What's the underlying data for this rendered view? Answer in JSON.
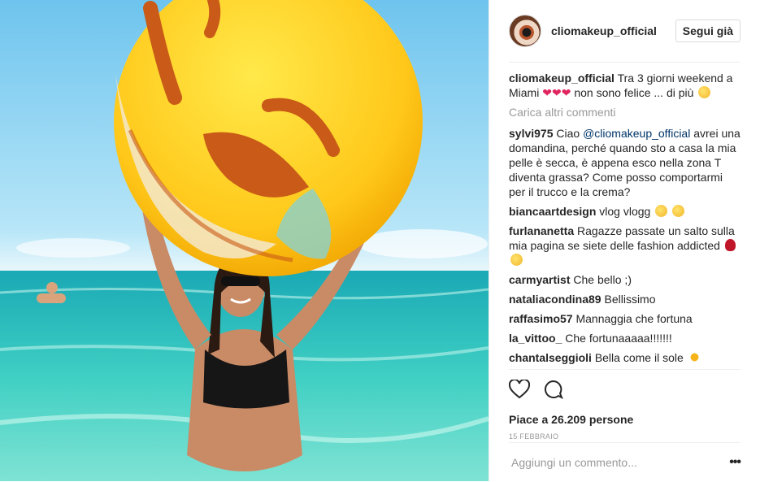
{
  "header": {
    "username": "cliomakeup_official",
    "follow_label": "Segui già"
  },
  "caption": {
    "user": "cliomakeup_official",
    "text_1": "Tra 3 giorni weekend a Miami",
    "hearts": "❤❤❤",
    "text_2": "non sono felice ... di più"
  },
  "load_more_label": "Carica altri commenti",
  "comments": [
    {
      "user": "sylvi975",
      "prefix": "Ciao",
      "mention": "@cliomakeup_official",
      "text": "avrei una domandina, perché quando sto a casa la mia pelle è secca, è appena esco nella zona T diventa grassa? Come posso comportarmi per il trucco e la crema?"
    },
    {
      "user": "biancaartdesign",
      "text": "vlog vlogg"
    },
    {
      "user": "furlananetta",
      "text": "Ragazze passate un salto sulla mia pagina se siete delle fashion addicted"
    },
    {
      "user": "carmyartist",
      "text": "Che bello ;)"
    },
    {
      "user": "nataliacondina89",
      "text": "Bellissimo"
    },
    {
      "user": "raffasimo57",
      "text": "Mannaggia che fortuna"
    },
    {
      "user": "la_vittoo_",
      "text": "Che fortunaaaaa!!!!!!!"
    },
    {
      "user": "chantalseggioli",
      "text": "Bella come il sole"
    }
  ],
  "likes_text": "Piace a 26.209 persone",
  "date": "15 FEBBRAIO",
  "comment_input": {
    "placeholder": "Aggiungi un commento..."
  },
  "icons": [
    "heart-icon",
    "comment-icon",
    "more-options-icon"
  ]
}
